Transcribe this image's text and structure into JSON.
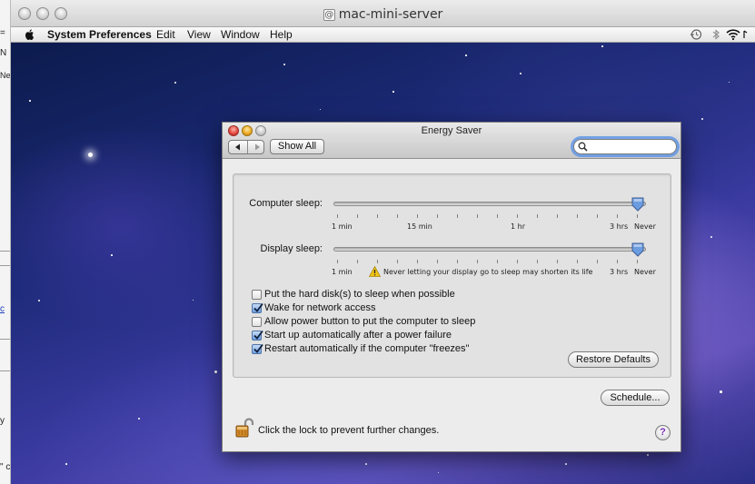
{
  "vnc_window": {
    "title": "mac-mini-server",
    "site_icon": "@"
  },
  "background_window": {
    "fragments": [
      "=",
      "N",
      "Ne",
      "c",
      "y",
      "\" c"
    ]
  },
  "menubar": {
    "apple_icon": "apple-logo-icon",
    "app_name": "System Preferences",
    "items": [
      "Edit",
      "View",
      "Window",
      "Help"
    ],
    "extras": [
      "time-machine-icon",
      "bluetooth-icon",
      "wifi-icon"
    ]
  },
  "energy_saver": {
    "title": "Energy Saver",
    "toolbar": {
      "back_icon": "back-arrow-icon",
      "forward_icon": "forward-arrow-icon",
      "show_all_label": "Show All",
      "search_value": "",
      "search_icon": "magnifier-icon"
    },
    "computer_sleep": {
      "label": "Computer sleep:",
      "tick_labels": [
        "1 min",
        "15 min",
        "1 hr",
        "3 hrs",
        "Never"
      ],
      "value": "Never"
    },
    "display_sleep": {
      "label": "Display sleep:",
      "tick_labels": [
        "1 min",
        "3 hrs",
        "Never"
      ],
      "value": "Never",
      "warning": "Never letting your display go to sleep may shorten its life",
      "warning_icon": "warning-triangle-icon"
    },
    "options": [
      {
        "label": "Put the hard disk(s) to sleep when possible",
        "checked": false
      },
      {
        "label": "Wake for network access",
        "checked": true
      },
      {
        "label": "Allow power button to put the computer to sleep",
        "checked": false
      },
      {
        "label": "Start up automatically after a power failure",
        "checked": true
      },
      {
        "label": "Restart automatically if the computer \"freezes\"",
        "checked": true
      }
    ],
    "restore_defaults_label": "Restore Defaults",
    "schedule_label": "Schedule...",
    "lock_text": "Click the lock to prevent further changes.",
    "lock_icon": "unlocked-padlock-icon",
    "help_label": "?"
  },
  "colors": {
    "check_fill": "#6c9de0",
    "slider_knob": "#5f8fd6",
    "warning_yellow": "#f3c514",
    "help_purple": "#7a2fb8"
  }
}
